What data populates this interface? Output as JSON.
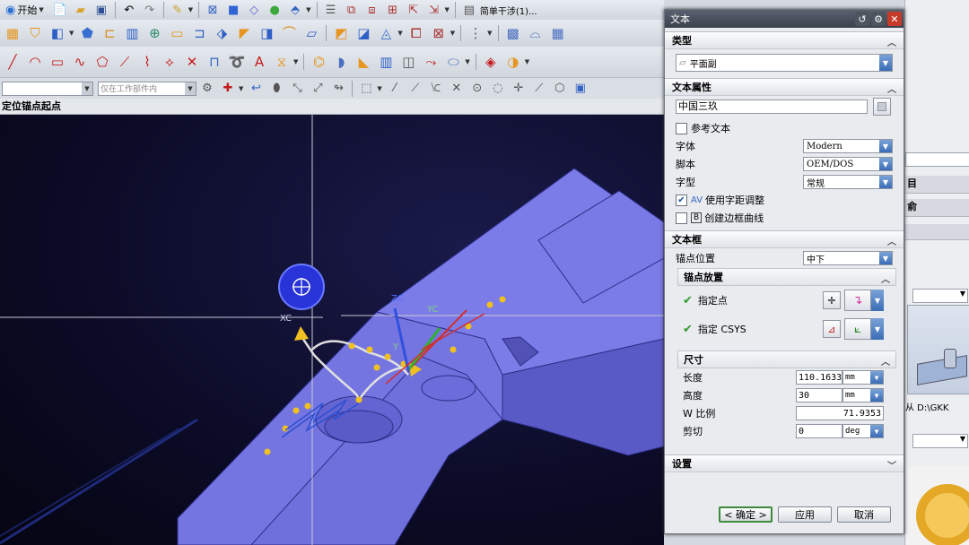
{
  "toolbar": {
    "start_label": "开始",
    "filter_combo_text": "仅在工作部件内",
    "simple_label": "简单干涉(1)..."
  },
  "status": {
    "prompt": "定位锚点起点"
  },
  "viewport": {
    "axis_label_zc": "ZC",
    "axis_label_yc": "YC",
    "axis_label_xc": "XC",
    "axis_label_y": "Y",
    "axis_label_z": "Z"
  },
  "dialog": {
    "title": "文本",
    "sections": {
      "type": {
        "label": "类型",
        "value": "平面副"
      },
      "text_props": {
        "label": "文本属性",
        "text_value": "中国三玖",
        "ref_text_label": "参考文本",
        "font_label": "字体",
        "font_value": "Modern",
        "script_label": "脚本",
        "script_value": "OEM/DOS",
        "style_label": "字型",
        "style_value": "常规",
        "kerning_label": "使用字距调整",
        "kerning_checked": true,
        "border_label": "创建边框曲线",
        "border_checked": false
      },
      "text_box": {
        "label": "文本框",
        "anchor_pos_label": "锚点位置",
        "anchor_pos_value": "中下",
        "anchor_place": {
          "label": "锚点放置",
          "point_label": "指定点",
          "csys_label": "指定 CSYS"
        },
        "dimensions": {
          "label": "尺寸",
          "length_label": "长度",
          "length_value": "110.1633",
          "length_unit": "mm",
          "height_label": "高度",
          "height_value": "30",
          "height_unit": "mm",
          "wscale_label": "W 比例",
          "wscale_value": "71.9353",
          "shear_label": "剪切",
          "shear_value": "0",
          "shear_unit": "deg"
        }
      },
      "settings": {
        "label": "设置"
      }
    },
    "buttons": {
      "ok": "< 确定 >",
      "apply": "应用",
      "cancel": "取消"
    }
  },
  "right_panel": {
    "item1": "目",
    "item2": "俞",
    "path_text": "从 D:\\GKK"
  },
  "colors": {
    "viewport_bg": "#0b0b26",
    "part_face": "#7c7ce8",
    "part_face_dark": "#5656c4",
    "accent_blue": "#3a6cb6",
    "ok_green": "#3d8a3d"
  }
}
